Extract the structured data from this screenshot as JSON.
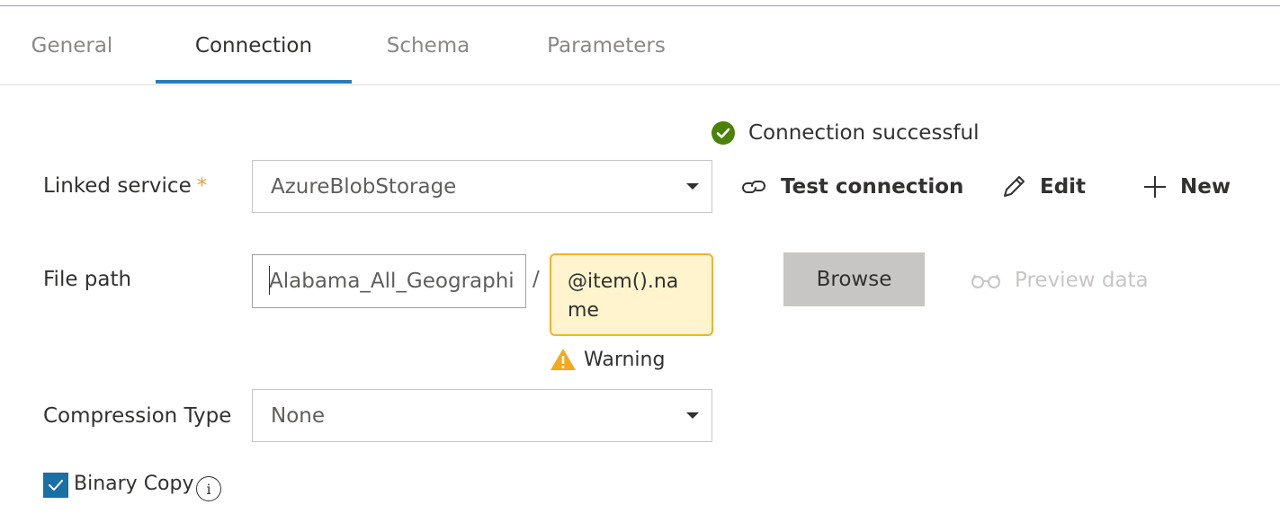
{
  "tabs": [
    {
      "label": "General"
    },
    {
      "label": "Connection"
    },
    {
      "label": "Schema"
    },
    {
      "label": "Parameters"
    }
  ],
  "active_tab": "Connection",
  "status": {
    "text": "Connection successful",
    "icon": "check-circle-icon",
    "color": "#498205"
  },
  "linked_service": {
    "label": "Linked service",
    "required_marker": "*",
    "value": "AzureBlobStorage"
  },
  "actions": {
    "test_connection": "Test connection",
    "edit": "Edit",
    "new": "New"
  },
  "file_path": {
    "label": "File path",
    "container_value": "Alabama_All_Geographi",
    "separator": "/",
    "file_expression": "@item().name",
    "warning_text": "Warning"
  },
  "browse": {
    "label": "Browse"
  },
  "preview": {
    "label": "Preview data"
  },
  "compression": {
    "label": "Compression Type",
    "value": "None"
  },
  "binary_copy": {
    "label": "Binary Copy",
    "checked": true
  },
  "colors": {
    "accent": "#2b7bb9",
    "warning_border": "#f0b429",
    "warning_bg": "#fff4ce",
    "checkbox": "#1a6fa5"
  }
}
